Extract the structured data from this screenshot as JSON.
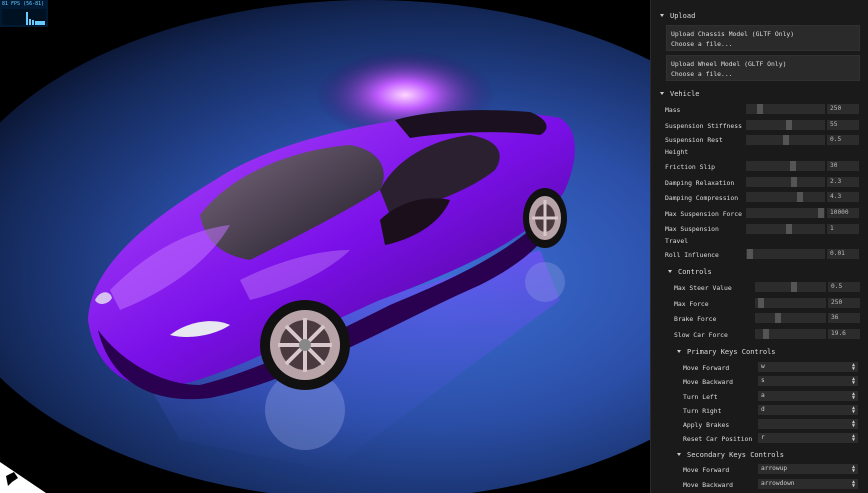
{
  "stats": {
    "fps_text": "81 FPS (56-81)"
  },
  "panel": {
    "upload": {
      "title": "Upload",
      "chassis_label": "Upload Chassis Model (GLTF Only)",
      "chassis_file": "Choose a file...",
      "wheel_label": "Upload Wheel Model (GLTF Only)",
      "wheel_file": "Choose a file..."
    },
    "vehicle": {
      "title": "Vehicle",
      "params": [
        {
          "label": "Mass",
          "value": "250",
          "level": 0.15
        },
        {
          "label": "Suspension Stiffness",
          "value": "55",
          "level": 0.55
        },
        {
          "label": "Suspension Rest Height",
          "value": "0.5",
          "level": 0.5
        },
        {
          "label": "Friction Slip",
          "value": "30",
          "level": 0.6
        },
        {
          "label": "Damping Relaxation",
          "value": "2.3",
          "level": 0.62
        },
        {
          "label": "Damping Compression",
          "value": "4.3",
          "level": 0.7
        },
        {
          "label": "Max Suspension Force",
          "value": "10000",
          "level": 0.99
        },
        {
          "label": "Max Suspension Travel",
          "value": "1",
          "level": 0.55
        },
        {
          "label": "Roll Influence",
          "value": "0.01",
          "level": 0.01
        }
      ],
      "controls": {
        "title": "Controls",
        "params": [
          {
            "label": "Max Steer Value",
            "value": "0.5",
            "level": 0.55
          },
          {
            "label": "Max Force",
            "value": "250",
            "level": 0.05
          },
          {
            "label": "Brake Force",
            "value": "36",
            "level": 0.3
          },
          {
            "label": "Slow Car Force",
            "value": "19.6",
            "level": 0.13
          }
        ],
        "primary": {
          "title": "Primary Keys Controls",
          "items": [
            {
              "label": "Move Forward",
              "value": "w"
            },
            {
              "label": "Move Backward",
              "value": "s"
            },
            {
              "label": "Turn Left",
              "value": "a"
            },
            {
              "label": "Turn Right",
              "value": "d"
            },
            {
              "label": "Apply Brakes",
              "value": ""
            },
            {
              "label": "Reset Car Position",
              "value": "r"
            }
          ]
        },
        "secondary": {
          "title": "Secondary Keys Controls",
          "items": [
            {
              "label": "Move Forward",
              "value": "arrowup"
            },
            {
              "label": "Move Backward",
              "value": "arrowdown"
            }
          ]
        }
      }
    }
  },
  "colors": {
    "car": "#8a1cf0",
    "floor": "#3a6ad0",
    "panel_bg": "#1a1a1a",
    "slider_bg": "#2c2c2c"
  }
}
